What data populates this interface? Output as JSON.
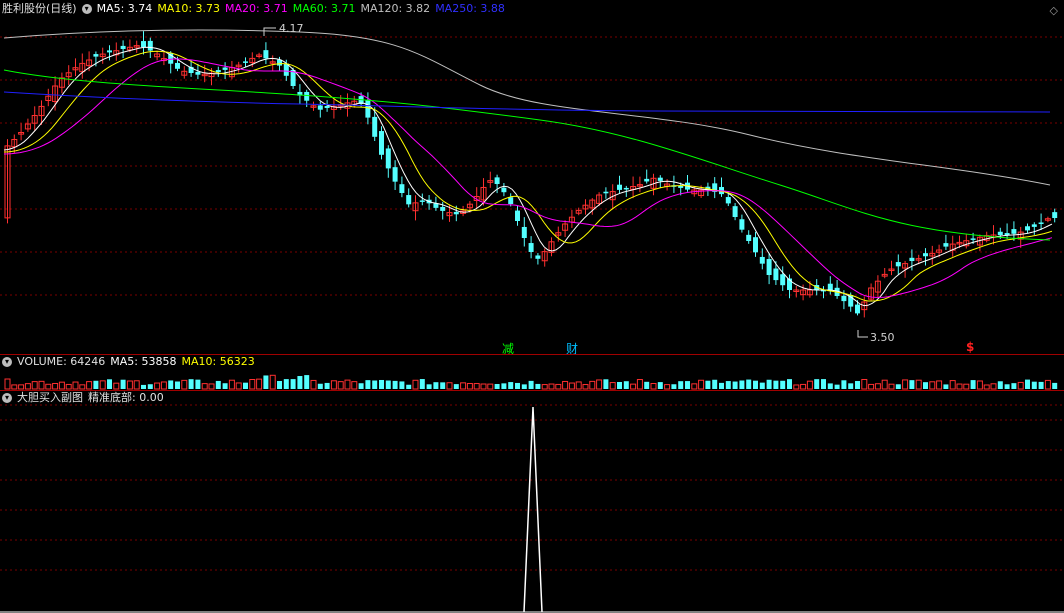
{
  "main": {
    "title": "胜利股份(日线)",
    "ma": [
      {
        "label": "MA5: 3.74",
        "color": "#ffffff"
      },
      {
        "label": "MA10: 3.73",
        "color": "#ffff00"
      },
      {
        "label": "MA20: 3.71",
        "color": "#ff00ff"
      },
      {
        "label": "MA60: 3.71",
        "color": "#00ff00"
      },
      {
        "label": "MA120: 3.82",
        "color": "#c0c0c0"
      },
      {
        "label": "MA250: 3.88",
        "color": "#0000ff"
      }
    ],
    "high_label": "4.17",
    "low_label": "3.50",
    "markers": [
      {
        "text": "减",
        "color": "#00ff00"
      },
      {
        "text": "财",
        "color": "#00bfff"
      },
      {
        "text": "$",
        "color": "#ff2020"
      }
    ]
  },
  "volume": {
    "label": "VOLUME: 64246",
    "ma5": "MA5: 53858",
    "ma10": "MA10: 56323"
  },
  "indicator": {
    "name": "大胆买入副图",
    "value": "精准底部: 0.00"
  },
  "colors": {
    "up": "#ff3030",
    "down": "#54ffff",
    "grid": "#8b0000",
    "separator": "#a00000",
    "bg": "#000000"
  },
  "chart_data": {
    "type": "candlestick",
    "price_range": [
      3.5,
      4.17
    ],
    "high": 4.17,
    "low": 3.5,
    "indicator_peak": 1.0
  }
}
